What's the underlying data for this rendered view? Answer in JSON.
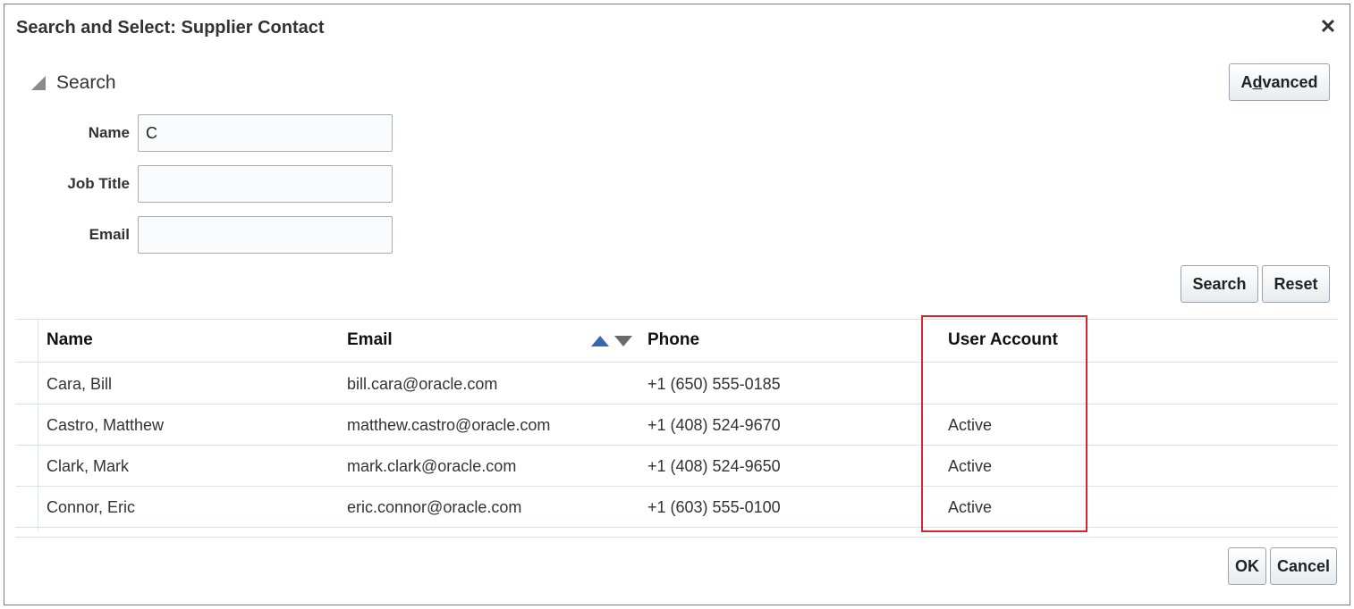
{
  "dialog": {
    "title": "Search and Select: Supplier Contact",
    "close_label": "✕"
  },
  "search": {
    "section_title": "Search",
    "advanced_prefix": "A",
    "advanced_underlined": "d",
    "advanced_suffix": "vanced",
    "fields": {
      "name": {
        "label": "Name",
        "value": "C"
      },
      "job_title": {
        "label": "Job Title",
        "value": ""
      },
      "email": {
        "label": "Email",
        "value": ""
      }
    },
    "search_button": "Search",
    "reset_button": "Reset"
  },
  "table": {
    "columns": [
      "Name",
      "Email",
      "Phone",
      "User Account"
    ],
    "rows": [
      {
        "name": "Cara, Bill",
        "email": "bill.cara@oracle.com",
        "phone": "+1 (650) 555-0185",
        "account": ""
      },
      {
        "name": "Castro, Matthew",
        "email": "matthew.castro@oracle.com",
        "phone": "+1 (408) 524-9670",
        "account": "Active"
      },
      {
        "name": "Clark, Mark",
        "email": "mark.clark@oracle.com",
        "phone": "+1 (408) 524-9650",
        "account": "Active"
      },
      {
        "name": "Connor, Eric",
        "email": "eric.connor@oracle.com",
        "phone": "+1 (603) 555-0100",
        "account": "Active"
      }
    ],
    "sort_icons": [
      "sort-ascending-icon",
      "sort-descending-icon"
    ]
  },
  "footer": {
    "ok_button": "OK",
    "cancel_button": "Cancel"
  },
  "colors": {
    "highlight": "#d9262e",
    "sort_ascending": "#3a66b0"
  }
}
